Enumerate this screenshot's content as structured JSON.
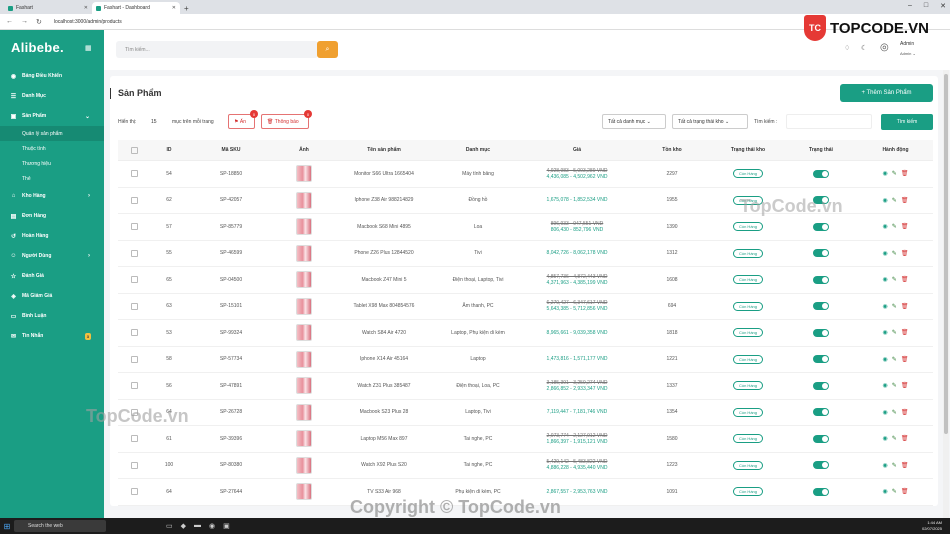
{
  "browser": {
    "tabs": [
      {
        "label": "Fashart",
        "active": false
      },
      {
        "label": "Fashart - Dashboard",
        "active": true
      }
    ],
    "url": "localhost:3000/admin/products"
  },
  "sidebar": {
    "logo": "Alibebe.",
    "items": [
      {
        "label": "Bảng Điều Khiển",
        "icon": "gauge-icon"
      },
      {
        "label": "Danh Mục",
        "icon": "list-icon"
      },
      {
        "label": "Sản Phẩm",
        "icon": "box-icon",
        "expanded": true
      },
      {
        "label": "Kho Hàng",
        "icon": "warehouse-icon",
        "arrow": true
      },
      {
        "label": "Đơn Hàng",
        "icon": "cart-icon"
      },
      {
        "label": "Hoàn Hàng",
        "icon": "return-icon"
      },
      {
        "label": "Người Dùng",
        "icon": "users-icon",
        "arrow": true
      },
      {
        "label": "Đánh Giá",
        "icon": "star-icon"
      },
      {
        "label": "Mã Giảm Giá",
        "icon": "ticket-icon"
      },
      {
        "label": "Bình Luận",
        "icon": "comment-icon"
      },
      {
        "label": "Tin Nhắn",
        "icon": "message-icon",
        "badge": "3"
      }
    ],
    "sub_items": [
      "Quản lý sản phẩm",
      "Thuộc tính",
      "Thương hiệu",
      "Thẻ"
    ]
  },
  "topbar": {
    "search_placeholder": "Tìm kiếm...",
    "admin_name": "Admin",
    "admin_role": "Admin"
  },
  "page": {
    "title": "Sản Phẩm",
    "add_button": "+ Thêm Sản Phẩm",
    "show_label": "Hiển thị:",
    "per_page": "15",
    "per_page_suffix": "mục trên mỗi trang",
    "hidden_btn": "Ẩn",
    "hidden_count": "0",
    "notice_btn": "Thông báo",
    "notice_count": "0",
    "category_filter": "Tất cả danh mục",
    "stock_filter": "Tất cả trạng thái kho",
    "search_label": "Tìm kiếm :",
    "search_button": "Tìm kiếm"
  },
  "table": {
    "headers": [
      "ID",
      "Mã SKU",
      "Ảnh",
      "Tên sản phẩm",
      "Danh mục",
      "Giá",
      "Tồn kho",
      "Trạng thái kho",
      "Trạng thái",
      "Hành động"
    ],
    "rows": [
      {
        "id": "54",
        "sku": "SP-18850",
        "name": "Monitor S66 Ultra 1665404",
        "category": "Máy tính bảng",
        "old_price": "4,928,983 - 5,003,289 VND",
        "price": "4,436,085 - 4,502,962 VND",
        "stock": "2297",
        "stock_status": "Còn Hàng"
      },
      {
        "id": "62",
        "sku": "SP-42057",
        "name": "Iphone Z38 Air 988214829",
        "category": "Đồng hồ",
        "old_price": "",
        "price": "1,675,078 - 1,852,534 VND",
        "stock": "1955",
        "stock_status": "Còn Hàng"
      },
      {
        "id": "57",
        "sku": "SP-85779",
        "name": "Macbook S68 Mini 4895",
        "category": "Loa",
        "old_price": "896,933 - 947,551 VND",
        "price": "806,430 - 852,796 VND",
        "stock": "1390",
        "stock_status": "Còn Hàng"
      },
      {
        "id": "55",
        "sku": "SP-46599",
        "name": "Phone Z26 Plus 12844520",
        "category": "Tivi",
        "old_price": "",
        "price": "8,042,726 - 8,062,178 VND",
        "stock": "1312",
        "stock_status": "Còn Hàng"
      },
      {
        "id": "65",
        "sku": "SP-04500",
        "name": "Macbook Z47 Mini 5",
        "category": "Điện thoại, Laptop, Tivi",
        "old_price": "4,857,736 - 4,872,443 VND",
        "price": "4,371,963 - 4,385,199 VND",
        "stock": "1608",
        "stock_status": "Còn Hàng"
      },
      {
        "id": "63",
        "sku": "SP-15101",
        "name": "Tablet X98 Max 804854576",
        "category": "Âm thanh, PC",
        "old_price": "6,270,427 - 6,347,617 VND",
        "price": "5,643,385 - 5,712,856 VND",
        "stock": "694",
        "stock_status": "Còn Hàng"
      },
      {
        "id": "53",
        "sku": "SP-99324",
        "name": "Watch S84 Air 4720",
        "category": "Laptop, Phụ kiện di kèm",
        "old_price": "",
        "price": "8,965,661 - 9,039,358 VND",
        "stock": "1818",
        "stock_status": "Còn Hàng"
      },
      {
        "id": "58",
        "sku": "SP-57734",
        "name": "Iphone X14 Air 45164",
        "category": "Laptop",
        "old_price": "",
        "price": "1,473,816 - 1,571,177 VND",
        "stock": "1221",
        "stock_status": "Còn Hàng"
      },
      {
        "id": "56",
        "sku": "SP-47891",
        "name": "Watch Z31 Plus 385487",
        "category": "Điện thoại, Loa, PC",
        "old_price": "3,185,391 - 3,259,274 VND",
        "price": "2,866,852 - 2,933,347 VND",
        "stock": "1337",
        "stock_status": "Còn Hàng"
      },
      {
        "id": "64",
        "sku": "SP-26728",
        "name": "Macbook S23 Plus 28",
        "category": "Laptop, Tivi",
        "old_price": "",
        "price": "7,119,447 - 7,181,746 VND",
        "stock": "1354",
        "stock_status": "Còn Hàng"
      },
      {
        "id": "61",
        "sku": "SP-39396",
        "name": "Laptop M56 Max 897",
        "category": "Tai nghe, PC",
        "old_price": "2,073,774 - 2,127,912 VND",
        "price": "1,866,397 - 1,915,121 VND",
        "stock": "1580",
        "stock_status": "Còn Hàng"
      },
      {
        "id": "100",
        "sku": "SP-80380",
        "name": "Watch X92 Plus S20",
        "category": "Tai nghe, PC",
        "old_price": "5,429,142 - 5,483,822 VND",
        "price": "4,886,228 - 4,935,440 VND",
        "stock": "1223",
        "stock_status": "Còn Hàng"
      },
      {
        "id": "64",
        "sku": "SP-27644",
        "name": "TV S33 Air 968",
        "category": "Phụ kiện di kèm, PC",
        "old_price": "",
        "price": "2,867,557 - 2,953,763 VND",
        "stock": "1091",
        "stock_status": "Còn Hàng"
      }
    ]
  },
  "taskbar": {
    "search": "Search the web",
    "time": "1:44 AM",
    "date": "02/07/2025"
  },
  "watermark": {
    "brand": "TOPCODE.VN",
    "shield": "TC",
    "text": "TopCode.vn",
    "copyright": "Copyright © TopCode.vn"
  },
  "colors": {
    "primary": "#1a9e84",
    "accent": "#f0a030",
    "danger": "#d32f2f"
  }
}
